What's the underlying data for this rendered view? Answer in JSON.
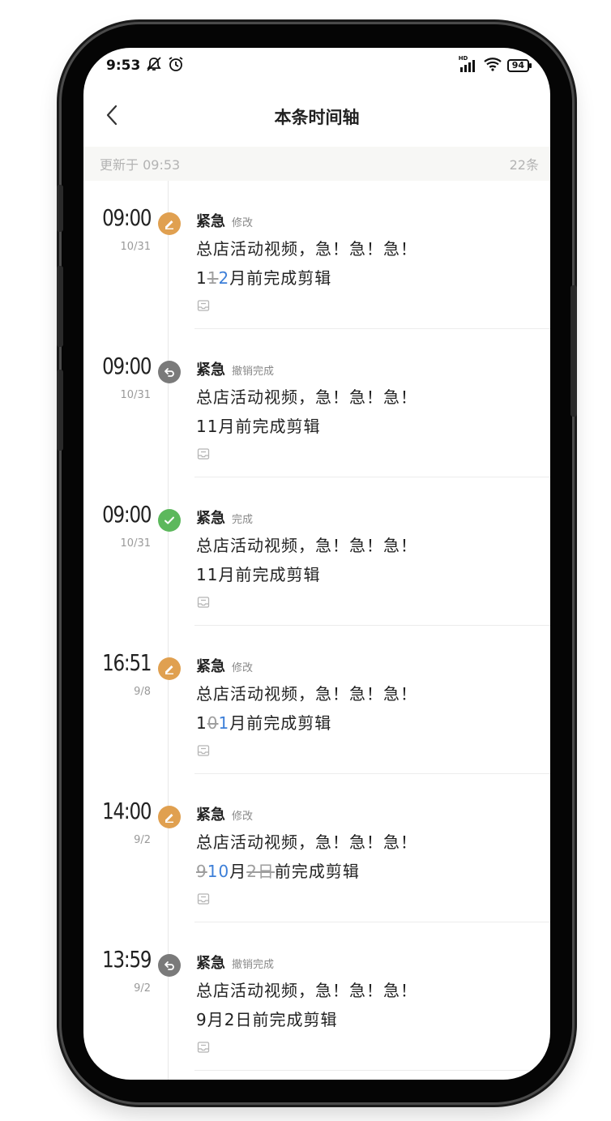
{
  "status_bar": {
    "time": "9:53",
    "battery": "94",
    "signal_label": "HD"
  },
  "header": {
    "title": "本条时间轴"
  },
  "update_bar": {
    "updated_text": "更新于 09:53",
    "count_text": "22条"
  },
  "colors": {
    "edit": "#e0a050",
    "undo": "#7a7a7a",
    "done": "#5cb85c",
    "insert": "#3d7fd8"
  },
  "entries": [
    {
      "time": "09:00",
      "date": "10/31",
      "icon": "edit-icon",
      "tag": "紧急",
      "action": "修改",
      "line1": "总店活动视频，急！急！急！",
      "line2": [
        {
          "t": "1",
          "s": "normal"
        },
        {
          "t": "1",
          "s": "del"
        },
        {
          "t": "2",
          "s": "ins"
        },
        {
          "t": "月前完成剪辑",
          "s": "normal"
        }
      ]
    },
    {
      "time": "09:00",
      "date": "10/31",
      "icon": "undo-icon",
      "tag": "紧急",
      "action": "撤销完成",
      "line1": "总店活动视频，急！急！急！",
      "line2": [
        {
          "t": "11月前完成剪辑",
          "s": "normal"
        }
      ]
    },
    {
      "time": "09:00",
      "date": "10/31",
      "icon": "check-icon",
      "tag": "紧急",
      "action": "完成",
      "line1": "总店活动视频，急！急！急！",
      "line2": [
        {
          "t": "11月前完成剪辑",
          "s": "normal"
        }
      ]
    },
    {
      "time": "16:51",
      "date": "9/8",
      "icon": "edit-icon",
      "tag": "紧急",
      "action": "修改",
      "line1": "总店活动视频，急！急！急！",
      "line2": [
        {
          "t": "1",
          "s": "normal"
        },
        {
          "t": "0",
          "s": "del"
        },
        {
          "t": "1",
          "s": "ins"
        },
        {
          "t": "月前完成剪辑",
          "s": "normal"
        }
      ]
    },
    {
      "time": "14:00",
      "date": "9/2",
      "icon": "edit-icon",
      "tag": "紧急",
      "action": "修改",
      "line1": "总店活动视频，急！急！急！",
      "line2": [
        {
          "t": "9",
          "s": "del"
        },
        {
          "t": "10",
          "s": "ins"
        },
        {
          "t": "月",
          "s": "normal"
        },
        {
          "t": "2日",
          "s": "del"
        },
        {
          "t": "前完成剪辑",
          "s": "normal"
        }
      ]
    },
    {
      "time": "13:59",
      "date": "9/2",
      "icon": "undo-icon",
      "tag": "紧急",
      "action": "撤销完成",
      "line1": "总店活动视频，急！急！急！",
      "line2": [
        {
          "t": "9月2日前完成剪辑",
          "s": "normal"
        }
      ]
    }
  ]
}
